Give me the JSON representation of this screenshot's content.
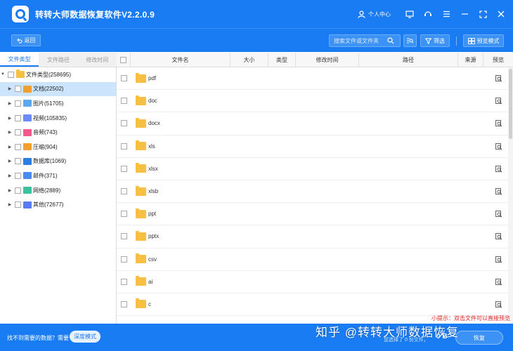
{
  "titlebar": {
    "title": "转转大师数据恢复软件V2.2.0.9",
    "user_label": "个人中心"
  },
  "toolbar": {
    "back_label": "返回",
    "search_placeholder": "搜索文件或文件夹",
    "filter_label": "筛选",
    "preview_mode_label": "预览模式"
  },
  "tabs": [
    "文件类型",
    "文件路径",
    "修改时间"
  ],
  "tree": [
    {
      "label": "文件类型(258695)",
      "expanded": true,
      "icon": "folder-icon",
      "color": "#f6c143"
    },
    {
      "label": "文档(22502)",
      "icon": "document-icon",
      "color": "#f0a030",
      "selected": true
    },
    {
      "label": "图片(51705)",
      "icon": "image-icon",
      "color": "#5aa9f0"
    },
    {
      "label": "视频(105835)",
      "icon": "video-icon",
      "color": "#6a8cf5"
    },
    {
      "label": "音频(743)",
      "icon": "audio-icon",
      "color": "#f05a8a"
    },
    {
      "label": "压缩(904)",
      "icon": "archive-icon",
      "color": "#f0a030"
    },
    {
      "label": "数据库(1069)",
      "icon": "database-icon",
      "color": "#2a7fe0"
    },
    {
      "label": "邮件(371)",
      "icon": "mail-icon",
      "color": "#4a8af0"
    },
    {
      "label": "网络(2889)",
      "icon": "network-icon",
      "color": "#3cc0a0"
    },
    {
      "label": "其他(72677)",
      "icon": "other-icon",
      "color": "#5a7cf0"
    }
  ],
  "table": {
    "columns": [
      "文件名",
      "大小",
      "类型",
      "修改时间",
      "路径",
      "来源",
      "预览"
    ],
    "rows": [
      "pdf",
      "doc",
      "docx",
      "xls",
      "xlsx",
      "xlsb",
      "ppt",
      "pptx",
      "csv",
      "ai",
      "c"
    ]
  },
  "tip": "小提示：双击文件可以直接预览",
  "bottom": {
    "not_found_text": "找不到需要的数据？需要",
    "deep_mode_label": "深度模式",
    "selected_info": "您选择了 0 份文件，",
    "selected_count": "0 B",
    "recover_label": "恢复"
  },
  "watermark": "知乎 @转转大师数据恢复",
  "colors": {
    "accent": "#1a7cf2",
    "folder": "#f6c143",
    "selected_row": "#cce4fc",
    "tip": "#e02020"
  }
}
